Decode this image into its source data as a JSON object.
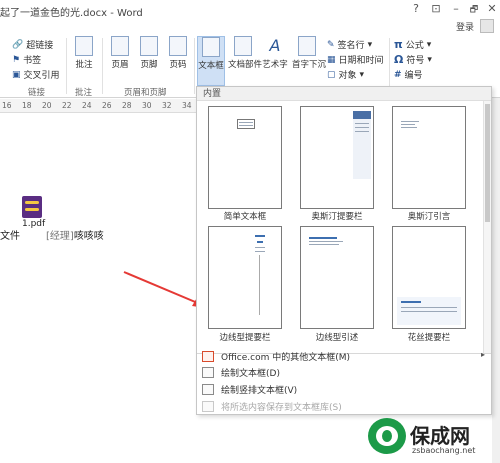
{
  "window": {
    "title": "起了一道金色的光.docx - Word",
    "help": "?",
    "ribbon_options": "⊡",
    "minimize": "–",
    "restore": "🗗",
    "close": "✕",
    "login": "登录"
  },
  "ribbon": {
    "links": {
      "hyperlink": "超链接",
      "bookmark": "书签",
      "cross_ref": "交叉引用",
      "group": "链接"
    },
    "comments": {
      "comment": "批注",
      "group": "批注"
    },
    "header_footer": {
      "header": "页眉",
      "footer": "页脚",
      "page_number": "页码",
      "group": "页眉和页脚"
    },
    "text": {
      "textbox": "文本框",
      "quick_parts": "文档部件",
      "wordart": "艺术字",
      "dropcap": "首字下沉",
      "signature": "签名行",
      "datetime": "日期和时间",
      "object": "对象"
    },
    "symbols": {
      "equation": "公式",
      "symbol": "符号",
      "number": "编号"
    }
  },
  "ruler": {
    "ticks": [
      "16",
      "18",
      "20",
      "22",
      "24",
      "26",
      "28",
      "30",
      "32",
      "34"
    ]
  },
  "document": {
    "file_label": "1.pdf",
    "text_prefix": "文件",
    "text_main": "[经理]",
    "text_suffix": "咳咳咳"
  },
  "dropdown": {
    "section": "内置",
    "items": [
      {
        "label": "简单文本框"
      },
      {
        "label": "奥斯汀提要栏"
      },
      {
        "label": "奥斯汀引言"
      },
      {
        "label": "边线型提要栏"
      },
      {
        "label": "边线型引述"
      },
      {
        "label": "花丝提要栏"
      }
    ],
    "menu": {
      "more": "Office.com 中的其他文本框(M)",
      "draw": "绘制文本框(D)",
      "draw_vertical": "绘制竖排文本框(V)",
      "save_selection": "将所选内容保存到文本框库(S)"
    }
  },
  "watermark": {
    "title": "保成网",
    "url": "zsbaochang.net"
  },
  "colors": {
    "accent": "#2b5797",
    "arrow": "#e53935",
    "brand_green": "#1c9a48"
  }
}
